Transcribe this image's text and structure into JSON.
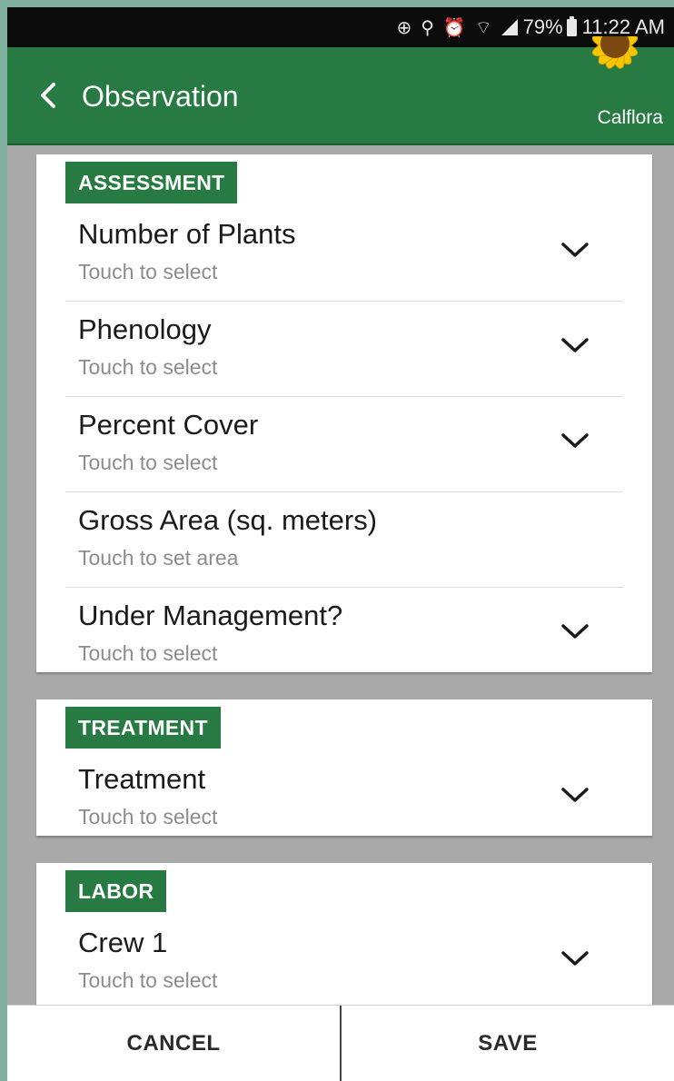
{
  "status_bar": {
    "battery_percent": "79%",
    "time": "11:22 AM"
  },
  "app_bar": {
    "title": "Observation",
    "logo_text": "Calflora"
  },
  "sections": {
    "assessment": {
      "badge": "ASSESSMENT",
      "fields": [
        {
          "label": "Number of Plants",
          "hint": "Touch to select"
        },
        {
          "label": "Phenology",
          "hint": "Touch to select"
        },
        {
          "label": "Percent Cover",
          "hint": "Touch to select"
        },
        {
          "label": "Gross Area (sq. meters)",
          "hint": "Touch to set area"
        },
        {
          "label": "Under Management?",
          "hint": "Touch to select"
        }
      ]
    },
    "treatment": {
      "badge": "TREATMENT",
      "fields": [
        {
          "label": "Treatment",
          "hint": "Touch to select"
        }
      ]
    },
    "labor": {
      "badge": "LABOR",
      "fields": [
        {
          "label": "Crew 1",
          "hint": "Touch to select"
        }
      ]
    }
  },
  "bottom_bar": {
    "cancel_label": "CANCEL",
    "save_label": "SAVE"
  },
  "colors": {
    "brand_green": "#267a42",
    "page_gray": "#a9a9a9"
  }
}
